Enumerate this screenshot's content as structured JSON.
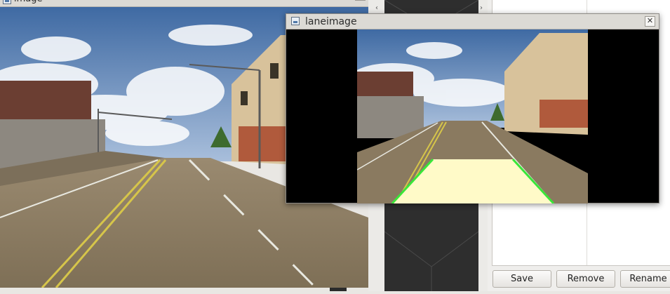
{
  "image_window": {
    "title": "image",
    "close": "✕"
  },
  "lane_window": {
    "title": "laneimage",
    "close": "✕"
  },
  "side_arrows": {
    "left": "‹",
    "right": "›"
  },
  "buttons": {
    "save": "Save",
    "remove": "Remove",
    "rename": "Rename"
  },
  "colors": {
    "sky": "#5b82b4",
    "road": "#8a7a60",
    "lane_overlay": "#fffac8",
    "lane_edge": "#39e639",
    "title_bar": "#dcdad5"
  }
}
